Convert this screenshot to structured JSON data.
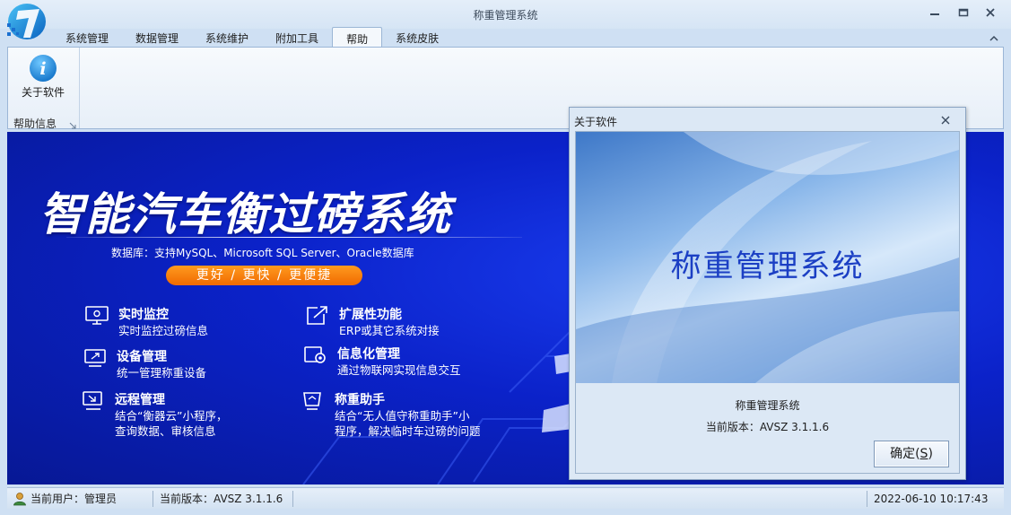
{
  "window": {
    "title": "称重管理系统"
  },
  "ribbon_tabs": [
    {
      "label": "系统管理"
    },
    {
      "label": "数据管理"
    },
    {
      "label": "系统维护"
    },
    {
      "label": "附加工具"
    },
    {
      "label": "帮助",
      "active": true
    },
    {
      "label": "系统皮肤"
    }
  ],
  "ribbon": {
    "about_label": "关于软件",
    "group_label": "帮助信息",
    "about_icon": "info-icon"
  },
  "banner": {
    "title": "智能汽车衡过磅系统",
    "subtitle": "数据库：支持MySQL、Microsoft SQL Server、Oracle数据库",
    "slogan": "更好 / 更快 / 更便捷",
    "features": [
      {
        "icon": "monitor-icon",
        "title": "实时监控",
        "desc": "实时监控过磅信息"
      },
      {
        "icon": "expand-icon",
        "title": "扩展性功能",
        "desc": "ERP或其它系统对接"
      },
      {
        "icon": "device-icon",
        "title": "设备管理",
        "desc": "统一管理称重设备"
      },
      {
        "icon": "gear-icon",
        "title": "信息化管理",
        "desc": "通过物联网实现信息交互"
      },
      {
        "icon": "remote-icon",
        "title": "远程管理",
        "desc1": "结合“衡器云”小程序，",
        "desc2": "查询数据、审核信息"
      },
      {
        "icon": "scale-icon",
        "title": "称重助手",
        "desc1": "结合“无人值守称重助手”小",
        "desc2": "程序，解决临时车过磅的问题"
      }
    ]
  },
  "dialog": {
    "title": "关于软件",
    "splash_title": "称重管理系统",
    "app_name": "称重管理系统",
    "version": "当前版本：AVSZ 3.1.1.6",
    "ok_label": "确定(",
    "ok_mnemonic": "S",
    "ok_close": ")"
  },
  "statusbar": {
    "user": "当前用户：管理员",
    "version": "当前版本：AVSZ 3.1.1.6",
    "datetime": "2022-06-10 10:17:43"
  },
  "colors": {
    "banner_blue": "#0b22c9",
    "slogan_orange": "#f27a0a",
    "splash_title": "#1b3fc4",
    "ribbon_border": "#9bb6d6"
  }
}
